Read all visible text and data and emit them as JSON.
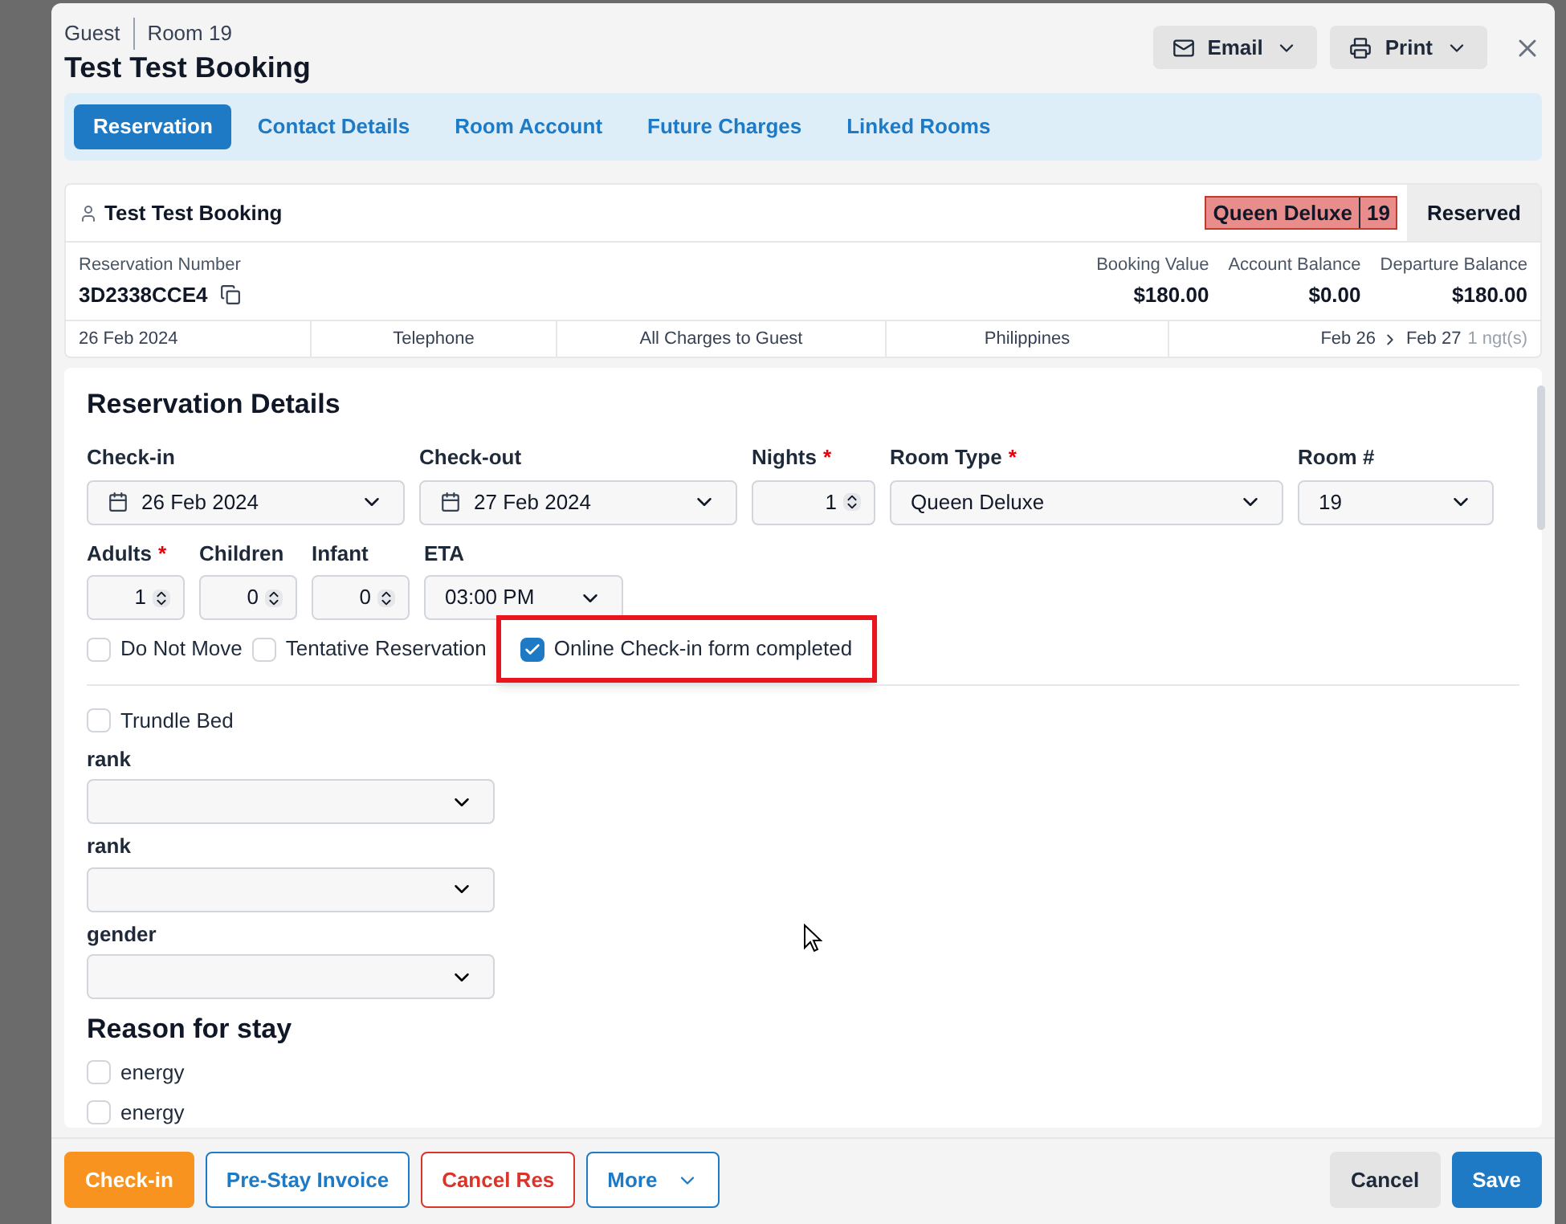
{
  "header": {
    "guest_label": "Guest",
    "room_label": "Room 19",
    "title": "Test Test Booking"
  },
  "actions": [
    {
      "label": "Email",
      "kind": "email"
    },
    {
      "label": "Print",
      "kind": "print"
    }
  ],
  "tabs": [
    {
      "label": "Reservation",
      "selected": true
    },
    {
      "label": "Contact Details",
      "selected": false
    },
    {
      "label": "Room Account",
      "selected": false
    },
    {
      "label": "Future Charges",
      "selected": false
    },
    {
      "label": "Linked Rooms",
      "selected": false
    }
  ],
  "summary": {
    "guest_name": "Test Test Booking",
    "room_type": "Queen Deluxe",
    "room_number": "19",
    "status": "Reserved",
    "reservation_number_label": "Reservation Number",
    "reservation_number": "3D2338CCE4",
    "balances": [
      {
        "label": "Booking Value",
        "value": "$180.00"
      },
      {
        "label": "Account Balance",
        "value": "$0.00"
      },
      {
        "label": "Departure Balance",
        "value": "$180.00"
      }
    ],
    "info": [
      "26 Feb 2024",
      "Telephone",
      "All Charges to Guest",
      "Philippines"
    ],
    "arrival": "Feb 26",
    "departure": "Feb 27",
    "nights": "1 ngt(s)"
  },
  "details": {
    "title": "Reservation Details",
    "row_1": [
      {
        "label": "Check-in",
        "kind": "date",
        "value": "26 Feb 2024"
      },
      {
        "label": "Check-out",
        "kind": "date",
        "value": "27 Feb 2024"
      },
      {
        "label": "Nights",
        "kind": "number",
        "value": "1",
        "required_mark": "*"
      },
      {
        "label": "Room Type",
        "kind": "select",
        "value": "Queen Deluxe",
        "required_mark": "*"
      },
      {
        "label": "Room #",
        "kind": "select",
        "value": "19"
      }
    ],
    "row_2": [
      {
        "label": "Adults",
        "kind": "number",
        "value": "1",
        "required_mark": "*"
      },
      {
        "label": "Children",
        "kind": "number",
        "value": "0"
      },
      {
        "label": "Infant",
        "kind": "number",
        "value": "0"
      },
      {
        "label": "ETA",
        "kind": "select",
        "value": "03:00 PM"
      }
    ],
    "flags": [
      {
        "label": "Do Not Move",
        "checked": false,
        "highlighted": false
      },
      {
        "label": "Tentative Reservation",
        "checked": false,
        "highlighted": false
      },
      {
        "label": "Online Check-in form completed",
        "checked": true,
        "highlighted": true
      }
    ],
    "trundle": {
      "label": "Trundle Bed",
      "checked": false
    },
    "custom_fields": [
      {
        "label": "rank"
      },
      {
        "label": "rank"
      },
      {
        "label": "gender"
      }
    ],
    "reason_title": "Reason for stay",
    "reasons": [
      {
        "label": "energy",
        "checked": false
      },
      {
        "label": "energy",
        "checked": false
      }
    ]
  },
  "footer_left": [
    {
      "label": "Check-in",
      "kind": "primary"
    },
    {
      "label": "Pre-Stay Invoice",
      "kind": "outline"
    },
    {
      "label": "Cancel Res",
      "kind": "danger"
    },
    {
      "label": "More",
      "kind": "menu"
    }
  ],
  "footer_right": [
    {
      "label": "Cancel",
      "kind": "secondary"
    },
    {
      "label": "Save",
      "kind": "save"
    }
  ]
}
